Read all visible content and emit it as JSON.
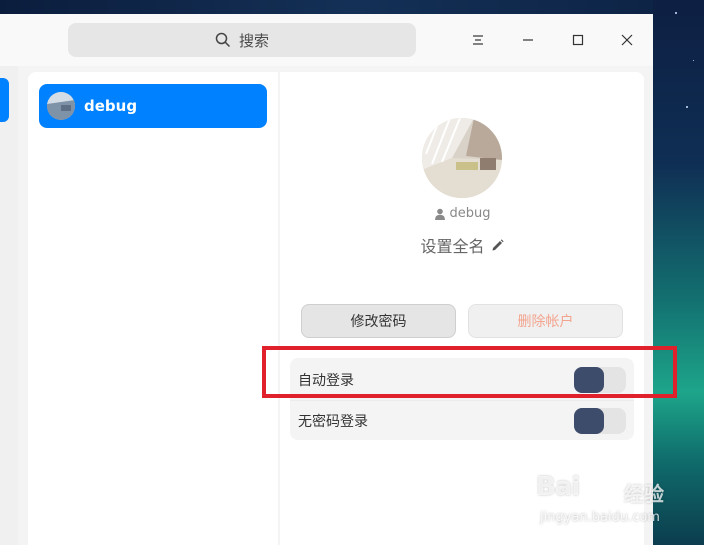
{
  "titlebar": {
    "search_label": "搜索",
    "menu_icon": "menu-icon",
    "minimize_icon": "minimize-icon",
    "maximize_icon": "maximize-icon",
    "close_icon": "close-icon"
  },
  "account_list": {
    "items": [
      {
        "name": "debug",
        "selected": true
      }
    ]
  },
  "account_detail": {
    "username": "debug",
    "full_name_placeholder": "设置全名",
    "change_password_label": "修改密码",
    "delete_account_label": "删除帐户",
    "settings": [
      {
        "label": "自动登录",
        "enabled": false
      },
      {
        "label": "无密码登录",
        "enabled": false
      }
    ]
  },
  "watermark": {
    "brand_left": "Bai",
    "brand_right": "经验",
    "url": "jingyan.baidu.com"
  },
  "colors": {
    "accent": "#0081ff",
    "toggle_knob": "#3e4c6b",
    "delete_text": "#f3a48f",
    "highlight": "#e0202a"
  }
}
